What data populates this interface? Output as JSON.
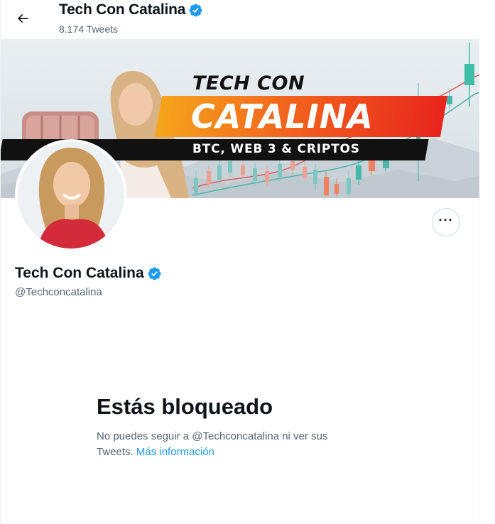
{
  "header": {
    "title": "Tech Con Catalina",
    "tweets_count": "8.174 Tweets"
  },
  "banner": {
    "text_top": "TECH CON",
    "text_main": "CATALINA",
    "text_sub": "BTC, WEB 3 & CRIPTOS"
  },
  "profile": {
    "name": "Tech Con Catalina",
    "handle": "@Techconcatalina",
    "more_label": "···"
  },
  "blocked": {
    "title": "Estás bloqueado",
    "text_part1": "No puedes seguir a @Techconcatalina ni ver sus Tweets.",
    "link_label": "Más información"
  },
  "colors": {
    "accent": "#1d9bf0",
    "verified": "#1d9bf0",
    "text_primary": "#0f1419",
    "text_secondary": "#536471"
  },
  "icons": {
    "back": "arrow-left-icon",
    "verified": "verified-badge-icon",
    "more": "more-dots-icon"
  }
}
